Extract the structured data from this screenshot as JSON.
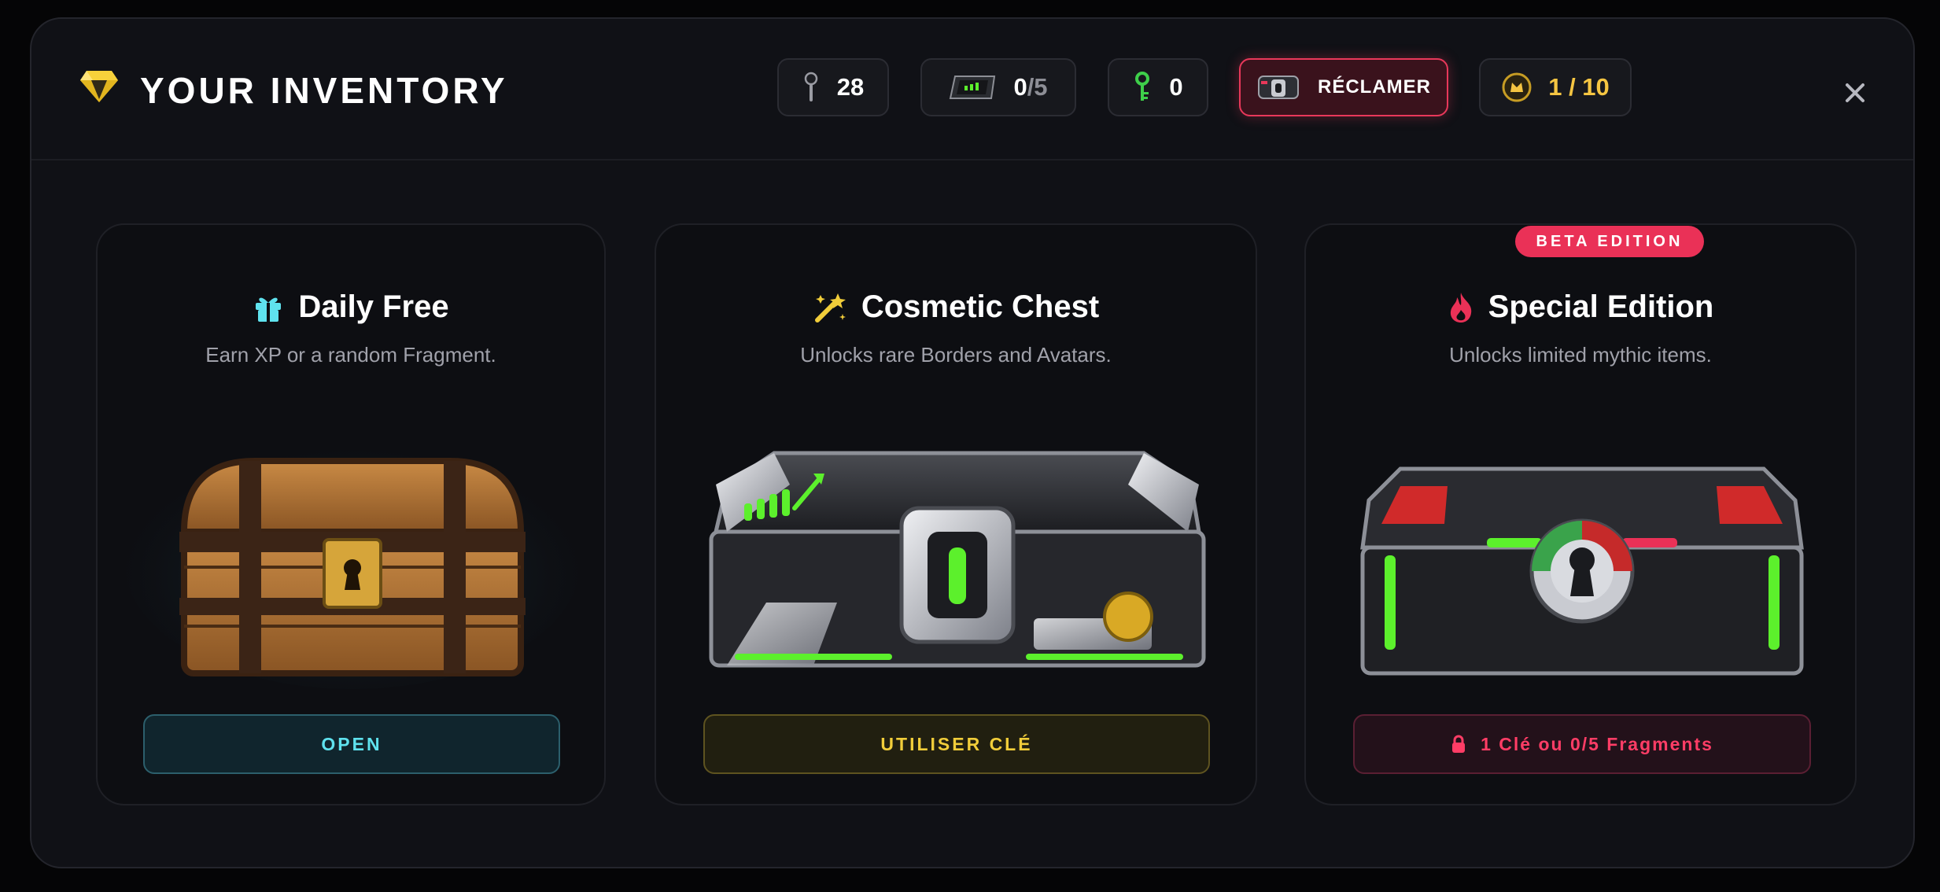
{
  "header": {
    "title": "YOUR INVENTORY",
    "brand_icon": "gem-icon",
    "stats": {
      "pin_count": "28",
      "fragments_have": "0",
      "fragments_total": "/5",
      "keys": "0",
      "claim_label": "RÉCLAMER",
      "level": "1 / 10"
    },
    "close_icon": "close-icon"
  },
  "cards": [
    {
      "title": "Daily Free",
      "icon": "gift-icon",
      "subtitle": "Earn XP or a random Fragment.",
      "button": "OPEN",
      "chest": "wooden-chest"
    },
    {
      "title": "Cosmetic Chest",
      "icon": "magic-wand-icon",
      "subtitle": "Unlocks rare Borders and Avatars.",
      "button": "UTILISER CLÉ",
      "chest": "steel-green-chest"
    },
    {
      "title": "Special Edition",
      "icon": "flame-icon",
      "subtitle": "Unlocks limited mythic items.",
      "button": "1 Clé ou 0/5 Fragments",
      "badge": "BETA EDITION",
      "chest": "steel-red-chest"
    }
  ],
  "colors": {
    "accent_cyan": "#5fe2ee",
    "accent_gold": "#f1cd3a",
    "accent_red": "#ff3d66",
    "gem_yellow": "#f7d13b",
    "chest_green": "#5cf02c"
  }
}
